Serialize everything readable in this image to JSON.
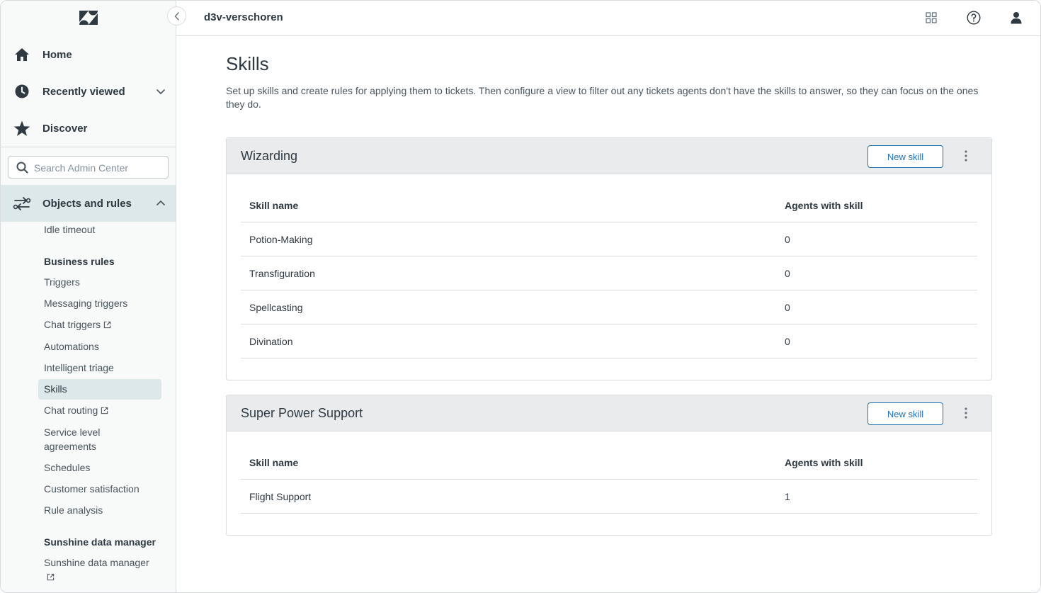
{
  "header": {
    "subdomain": "d3v-verschoren"
  },
  "sidebar": {
    "nav": [
      {
        "label": "Home",
        "icon": "home-icon"
      },
      {
        "label": "Recently viewed",
        "icon": "clock-icon"
      },
      {
        "label": "Discover",
        "icon": "star-icon"
      }
    ],
    "search_placeholder": "Search Admin Center",
    "section": {
      "label": "Objects and rules",
      "icon": "objects-rules-icon"
    },
    "links": {
      "idle_timeout": "Idle timeout",
      "business_rules_heading": "Business rules",
      "triggers": "Triggers",
      "messaging_triggers": "Messaging triggers",
      "chat_triggers": "Chat triggers",
      "automations": "Automations",
      "intelligent_triage": "Intelligent triage",
      "skills": "Skills",
      "chat_routing": "Chat routing",
      "sla_line1": "Service level",
      "sla_line2": "agreements",
      "schedules": "Schedules",
      "customer_satisfaction": "Customer satisfaction",
      "rule_analysis": "Rule analysis",
      "sunshine_heading": "Sunshine data manager",
      "sunshine_link": "Sunshine data manager"
    }
  },
  "page": {
    "title": "Skills",
    "description": "Set up skills and create rules for applying them to tickets. Then configure a view to filter out any tickets agents don't have the skills to answer, so they can focus on the ones they do."
  },
  "skill_types": [
    {
      "title": "Wizarding",
      "new_skill_label": "New skill",
      "columns": [
        "Skill name",
        "Agents with skill"
      ],
      "rows": [
        {
          "name": "Potion-Making",
          "agents": "0"
        },
        {
          "name": "Transfiguration",
          "agents": "0"
        },
        {
          "name": "Spellcasting",
          "agents": "0"
        },
        {
          "name": "Divination",
          "agents": "0"
        }
      ]
    },
    {
      "title": "Super Power Support",
      "new_skill_label": "New skill",
      "columns": [
        "Skill name",
        "Agents with skill"
      ],
      "rows": [
        {
          "name": "Flight Support",
          "agents": "1"
        }
      ]
    }
  ],
  "colors": {
    "accent": "#1f73b7",
    "active_bg": "#dce8ea",
    "card_head_bg": "#e9ebed"
  }
}
